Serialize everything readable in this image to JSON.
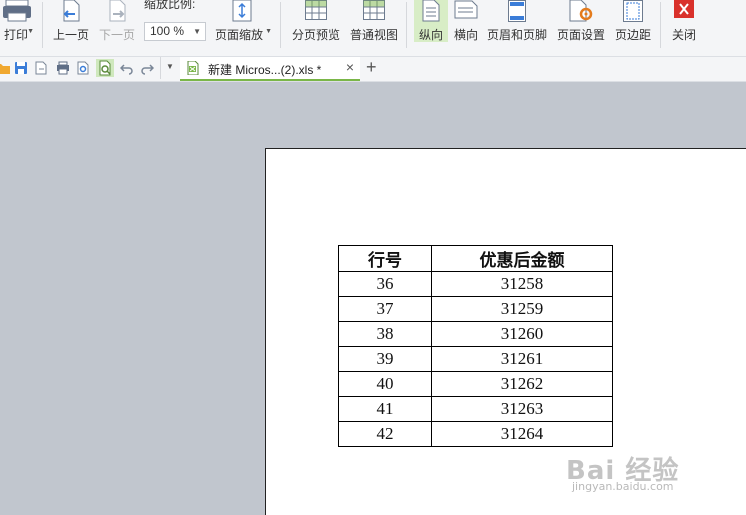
{
  "toolbar": {
    "print_label": "打印",
    "prev_page_label": "上一页",
    "next_page_label": "下一页",
    "zoom_ratio_label": "缩放比例:",
    "zoom_value": "100 %",
    "page_zoom_label": "页面缩放",
    "page_break_preview_label": "分页预览",
    "normal_view_label": "普通视图",
    "portrait_label": "纵向",
    "landscape_label": "横向",
    "header_footer_label": "页眉和页脚",
    "page_setup_label": "页面设置",
    "margins_label": "页边距",
    "close_label": "关闭"
  },
  "tabs": {
    "doc_title": "新建 Micros...(2).xls *"
  },
  "sheet": {
    "headers": [
      "行号",
      "优惠后金额"
    ],
    "rows": [
      [
        "36",
        "31258"
      ],
      [
        "37",
        "31259"
      ],
      [
        "38",
        "31260"
      ],
      [
        "39",
        "31261"
      ],
      [
        "40",
        "31262"
      ],
      [
        "41",
        "31263"
      ],
      [
        "42",
        "31264"
      ]
    ]
  },
  "watermark": {
    "brand": "Bai 经验",
    "url": "jingyan.baidu.com"
  },
  "colors": {
    "accent_green": "#7ab648",
    "close_red": "#d9312b",
    "background": "#c1c6ce"
  }
}
